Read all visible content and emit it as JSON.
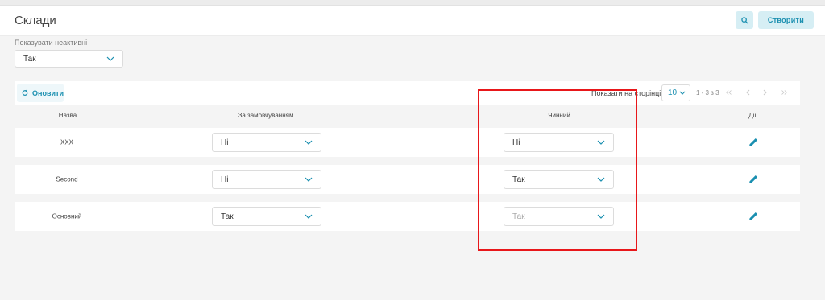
{
  "header": {
    "title": "Склади",
    "search_icon": "search-icon",
    "create_label": "Створити"
  },
  "filter": {
    "label": "Показувати неактивні",
    "value": "Так"
  },
  "toolbar": {
    "refresh_label": "Оновити",
    "per_page_label": "Показати на сторінці",
    "per_page_value": "10",
    "range_text": "1 - 3 з 3"
  },
  "table": {
    "columns": [
      "Назва",
      "За замовчуванням",
      "Чинний",
      "Дії"
    ],
    "rows": [
      {
        "name": "XXX",
        "default": "Ні",
        "active": "Ні",
        "active_disabled": false
      },
      {
        "name": "Second",
        "default": "Ні",
        "active": "Так",
        "active_disabled": false
      },
      {
        "name": "Основний",
        "default": "Так",
        "active": "Так",
        "active_disabled": true
      }
    ]
  },
  "colors": {
    "accent": "#1a8fb0",
    "highlight": "#e8171a",
    "button_bg": "#d6eef4"
  }
}
